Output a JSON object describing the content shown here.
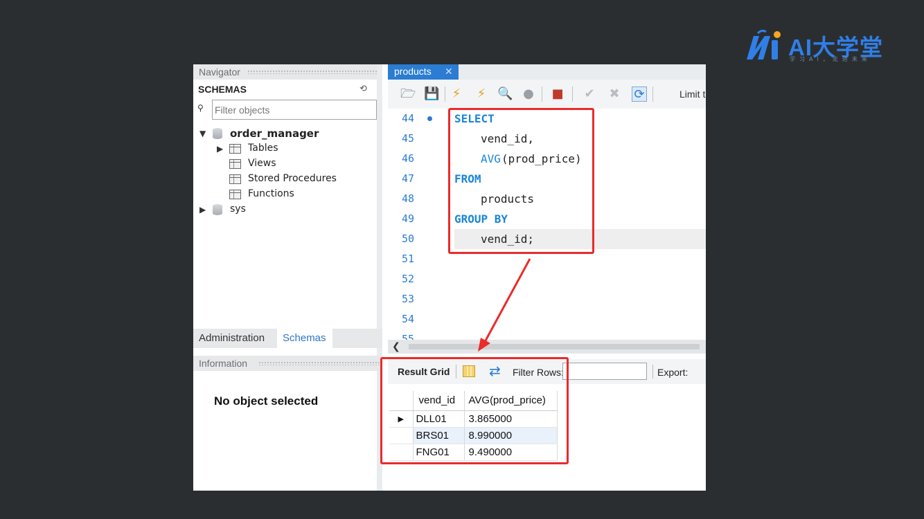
{
  "logo": {
    "text": "AI大学堂",
    "subtext": "学习AI，走进未来",
    "color": "#2f7fe8"
  },
  "navigator": {
    "title": "Navigator",
    "schemas_label": "SCHEMAS",
    "filter_placeholder": "Filter objects",
    "tree": {
      "db1": "order_manager",
      "tables": "Tables",
      "views": "Views",
      "stored_procedures": "Stored Procedures",
      "functions": "Functions",
      "db2": "sys"
    },
    "tabs": {
      "administration": "Administration",
      "schemas": "Schemas"
    },
    "info_title": "Information",
    "no_object": "No object selected"
  },
  "editor": {
    "tab_label": "products",
    "limit_text": "Limit t",
    "lines": [
      {
        "num": "44",
        "marker": true
      },
      {
        "num": "45"
      },
      {
        "num": "46"
      },
      {
        "num": "47"
      },
      {
        "num": "48"
      },
      {
        "num": "49"
      },
      {
        "num": "50"
      },
      {
        "num": "51"
      },
      {
        "num": "52"
      },
      {
        "num": "53"
      },
      {
        "num": "54"
      },
      {
        "num": "55"
      }
    ],
    "code": {
      "select": "SELECT",
      "vend_id_comma": "vend_id,",
      "avg_fn": "AVG",
      "avg_args": "(prod_price)",
      "from": "FROM",
      "products": "products",
      "group_by": "GROUP BY",
      "vend_id_semi": "vend_id;"
    }
  },
  "results": {
    "result_grid_label": "Result Grid",
    "filter_rows_label": "Filter Rows:",
    "export_label": "Export:",
    "columns": [
      "vend_id",
      "AVG(prod_price)"
    ],
    "rows": [
      [
        "DLL01",
        "3.865000"
      ],
      [
        "BRS01",
        "8.990000"
      ],
      [
        "FNG01",
        "9.490000"
      ]
    ]
  },
  "colors": {
    "accent": "#2b7cd3",
    "annotation_red": "#ec2a2a",
    "background": "#2b2e31"
  }
}
